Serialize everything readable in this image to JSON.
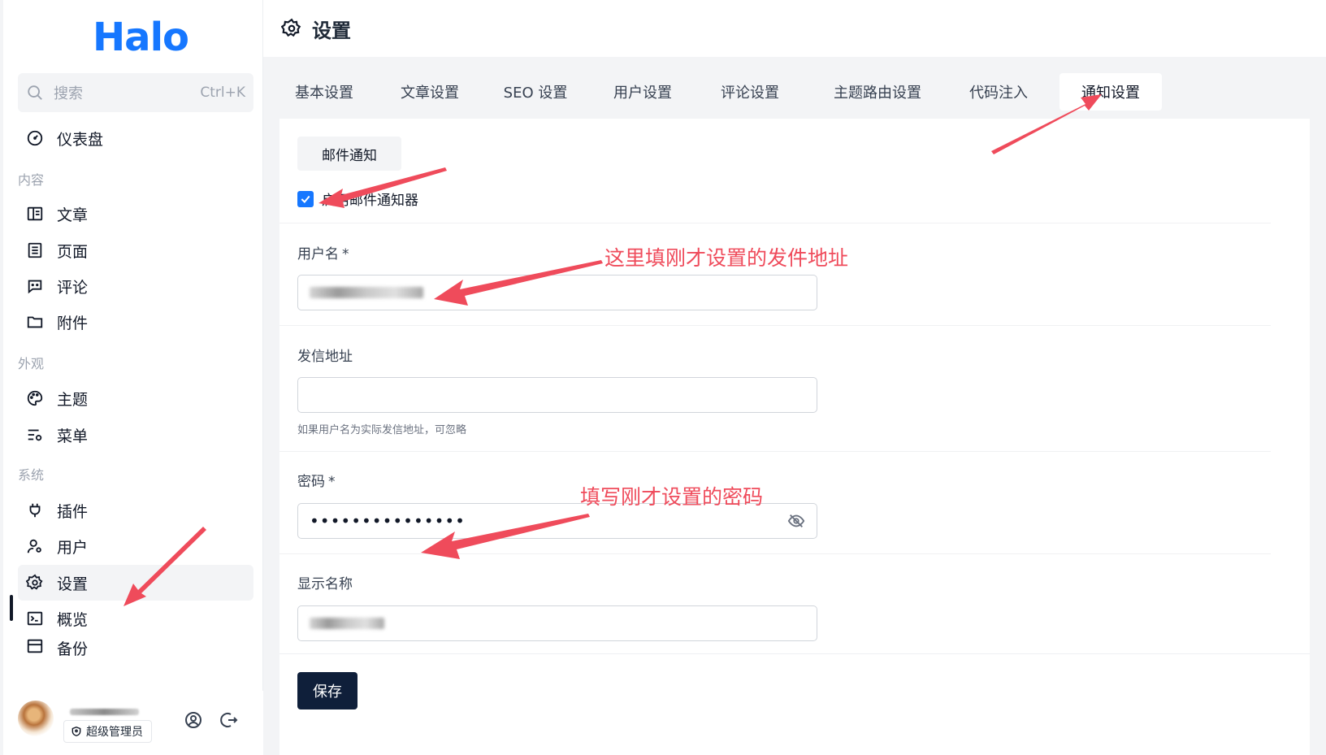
{
  "brand": {
    "logo_text": "Halo",
    "logo_color": "#1677ff"
  },
  "search": {
    "placeholder": "搜索",
    "shortcut": "Ctrl+K"
  },
  "sidebar": {
    "dashboard": "仪表盘",
    "groups": {
      "content": "内容",
      "appearance": "外观",
      "system": "系统"
    },
    "items": {
      "posts": "文章",
      "pages": "页面",
      "comments": "评论",
      "attachments": "附件",
      "themes": "主题",
      "menus": "菜单",
      "plugins": "插件",
      "users": "用户",
      "settings": "设置",
      "overview": "概览",
      "backup": "备份"
    }
  },
  "user": {
    "role": "超级管理员"
  },
  "header": {
    "title": "设置"
  },
  "tabs": [
    {
      "label": "基本设置"
    },
    {
      "label": "文章设置"
    },
    {
      "label": "SEO 设置"
    },
    {
      "label": "用户设置"
    },
    {
      "label": "评论设置"
    },
    {
      "label": "主题路由设置"
    },
    {
      "label": "代码注入"
    },
    {
      "label": "通知设置",
      "active": true
    }
  ],
  "subtab": {
    "label": "邮件通知"
  },
  "form": {
    "enable_label": "启用邮件通知器",
    "enable_checked": true,
    "username_label": "用户名",
    "required_mark": "*",
    "sender_label": "发信地址",
    "sender_hint": "如果用户名为实际发信地址，可忽略",
    "password_label": "密码",
    "password_value": "•••••••••••••••",
    "display_name_label": "显示名称",
    "save_label": "保存"
  },
  "annotations": {
    "username_note": "这里填刚才设置的发件地址",
    "password_note": "填写刚才设置的密码",
    "color": "#ef4b5b"
  },
  "colors": {
    "accent": "#1677ff",
    "primary_button": "#0f1f3a"
  }
}
